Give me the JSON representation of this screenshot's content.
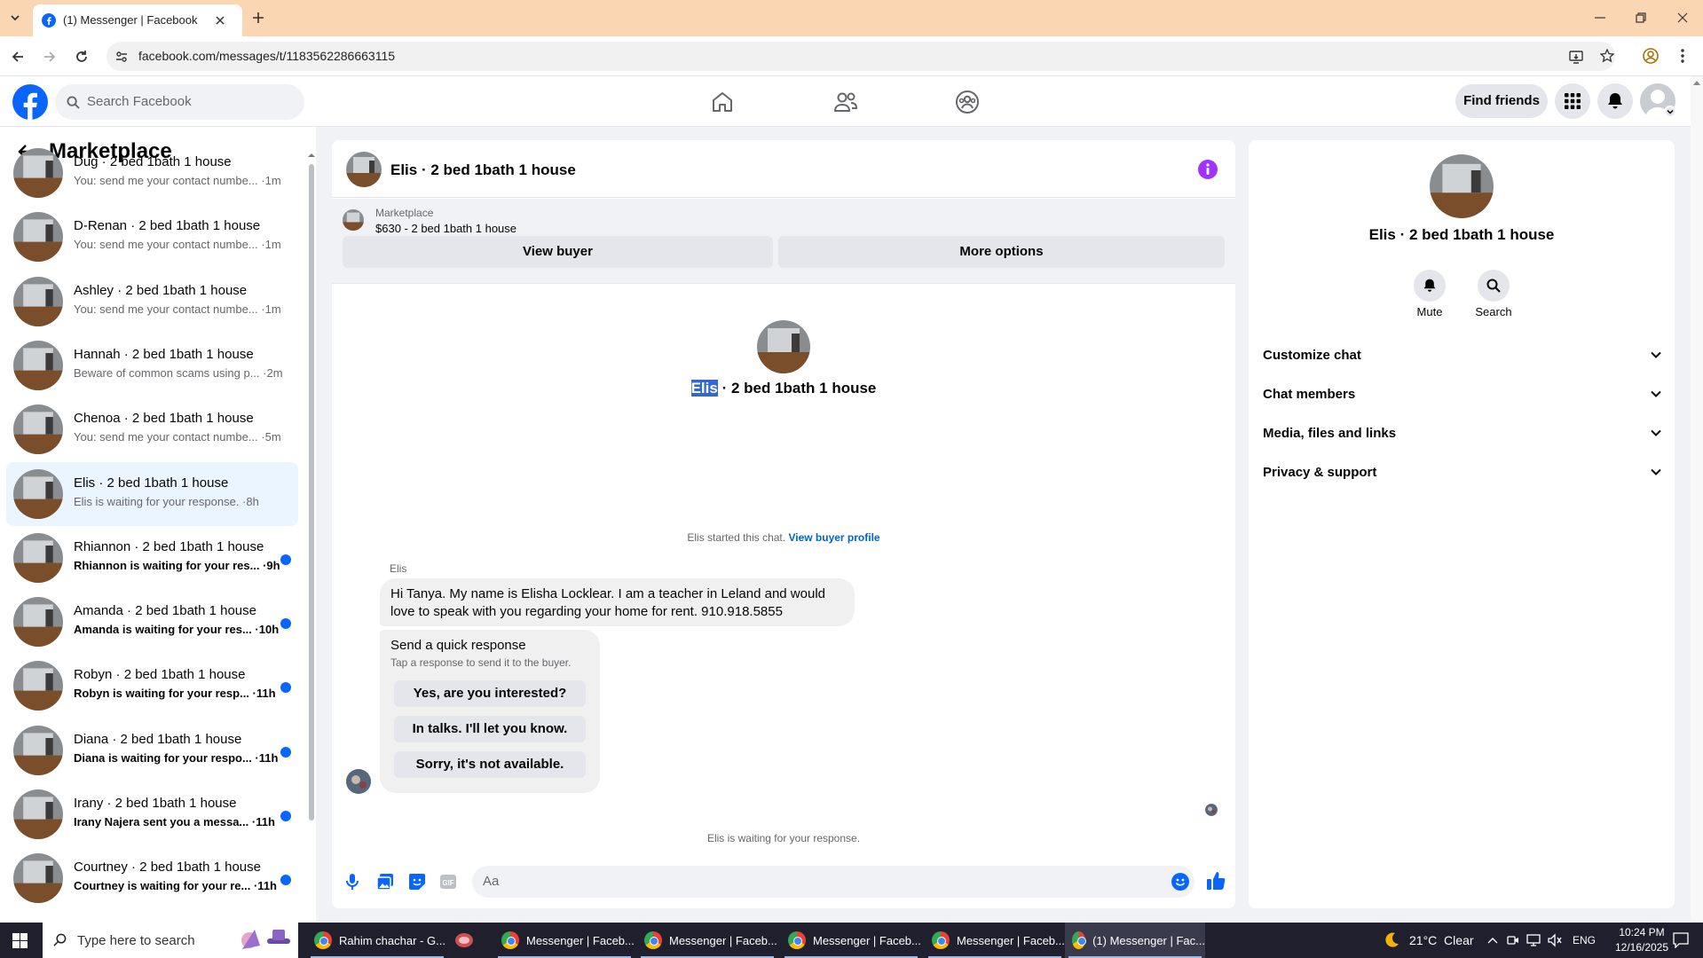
{
  "browser": {
    "tab_title": "(1) Messenger | Facebook",
    "url": "facebook.com/messages/t/1183562286663115"
  },
  "header": {
    "search_placeholder": "Search Facebook",
    "find_friends": "Find friends"
  },
  "left": {
    "title": "Marketplace",
    "conversations": [
      {
        "name": "Dug · 2 bed 1bath 1 house",
        "preview": "You: send me your contact numbe... ·1m",
        "unread": false
      },
      {
        "name": "D-Renan · 2 bed 1bath 1 house",
        "preview": "You: send me your contact numbe... ·1m",
        "unread": false
      },
      {
        "name": "Ashley · 2 bed 1bath 1 house",
        "preview": "You: send me your contact numbe... ·1m",
        "unread": false
      },
      {
        "name": "Hannah · 2 bed 1bath 1 house",
        "preview": "Beware of common scams using p... ·2m",
        "unread": false
      },
      {
        "name": "Chenoa · 2 bed 1bath 1 house",
        "preview": "You: send me your contact numbe... ·5m",
        "unread": false
      },
      {
        "name": "Elis · 2 bed 1bath 1 house",
        "preview": "Elis is waiting for your response. ·8h",
        "unread": false,
        "selected": true
      },
      {
        "name": "Rhiannon · 2 bed 1bath 1 house",
        "preview": "Rhiannon is waiting for your res... ·9h",
        "unread": true
      },
      {
        "name": "Amanda · 2 bed 1bath 1 house",
        "preview": "Amanda is waiting for your res... ·10h",
        "unread": true
      },
      {
        "name": "Robyn · 2 bed 1bath 1 house",
        "preview": "Robyn is waiting for your resp... ·11h",
        "unread": true
      },
      {
        "name": "Diana · 2 bed 1bath 1 house",
        "preview": "Diana is waiting for your respo... ·11h",
        "unread": true
      },
      {
        "name": "Irany · 2 bed 1bath 1 house",
        "preview": "Irany Najera sent you a messa... ·11h",
        "unread": true
      },
      {
        "name": "Courtney · 2 bed 1bath 1 house",
        "preview": "Courtney is waiting for your re... ·11h",
        "unread": true
      }
    ]
  },
  "chat": {
    "title": "Elis · 2 bed 1bath 1 house",
    "listing_label": "Marketplace",
    "listing_price": "$630 - 2 bed 1bath 1 house",
    "view_buyer": "View buyer",
    "more_options": "More options",
    "intro_name_highlight": "Elis",
    "intro_name_rest": " · 2 bed 1bath 1 house",
    "started_text": "Elis started this chat.",
    "view_buyer_profile": "View buyer profile",
    "sender": "Elis",
    "message": "Hi Tanya. My name is Elisha Locklear. I am a teacher in Leland and would love to speak with you regarding your home for rent. 910.918.5855",
    "quick_title": "Send a quick response",
    "quick_sub": "Tap a response to send it to the buyer.",
    "quick_replies": [
      "Yes, are you interested?",
      "In talks. I'll let you know.",
      "Sorry, it's not available."
    ],
    "waiting": "Elis is waiting for your response.",
    "composer_placeholder": "Aa"
  },
  "info": {
    "title": "Elis · 2 bed 1bath 1 house",
    "mute": "Mute",
    "search": "Search",
    "sections": [
      "Customize chat",
      "Chat members",
      "Media, files and links",
      "Privacy & support"
    ]
  },
  "taskbar": {
    "search_placeholder": "Type here to search",
    "apps": [
      "Rahim chachar - G...",
      "Messenger | Faceb...",
      "Messenger | Faceb...",
      "Messenger | Faceb...",
      "Messenger | Faceb...",
      "(1) Messenger | Fac..."
    ],
    "weather": "21°C  Clear",
    "lang": "ENG",
    "time": "10:24 PM",
    "date": "12/16/2025"
  },
  "colors": {
    "fb_blue": "#0866ff",
    "accent_purple": "#a033ff",
    "link_blue": "#0064d1"
  }
}
